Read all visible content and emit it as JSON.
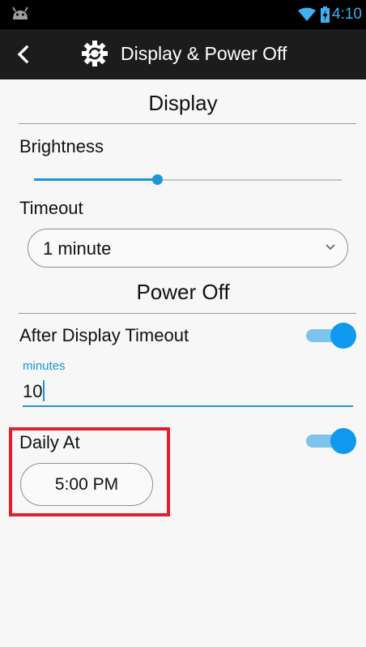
{
  "status_bar": {
    "time": "4:10",
    "icons": [
      "android-icon",
      "wifi-icon",
      "battery-charging-icon"
    ],
    "accent_color": "#3fb0f0"
  },
  "app_bar": {
    "title": "Display & Power Off",
    "back_icon": "chevron-left-icon",
    "title_icon": "gear-refresh-icon"
  },
  "display_section": {
    "title": "Display",
    "brightness": {
      "label": "Brightness",
      "value_fraction": 0.4
    },
    "timeout": {
      "label": "Timeout",
      "selected": "1 minute"
    }
  },
  "power_off_section": {
    "title": "Power Off",
    "after_display_timeout": {
      "label": "After Display Timeout",
      "enabled": true,
      "minutes_label": "minutes",
      "minutes_value": "10"
    },
    "daily_at": {
      "label": "Daily At",
      "enabled": true,
      "time": "5:00 PM"
    }
  },
  "colors": {
    "accent": "#1a98d8",
    "toggle_on": "#0f99ee",
    "highlight": "#e0202e",
    "background": "#f7f7f7",
    "app_bar": "#1c1c1c"
  }
}
